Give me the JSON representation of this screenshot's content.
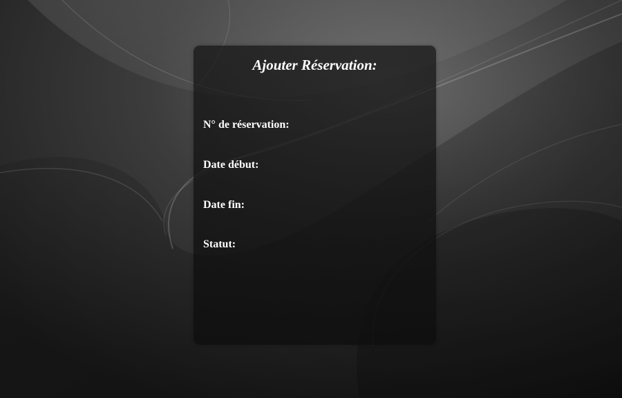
{
  "form": {
    "title": "Ajouter Réservation:",
    "labels": {
      "reservation_number": "N° de réservation:",
      "start_date": "Date début:",
      "end_date": "Date fin:",
      "status": "Statut:"
    }
  },
  "colors": {
    "background": "#2b2b2b",
    "panel": "#161616",
    "text": "#ffffff"
  }
}
